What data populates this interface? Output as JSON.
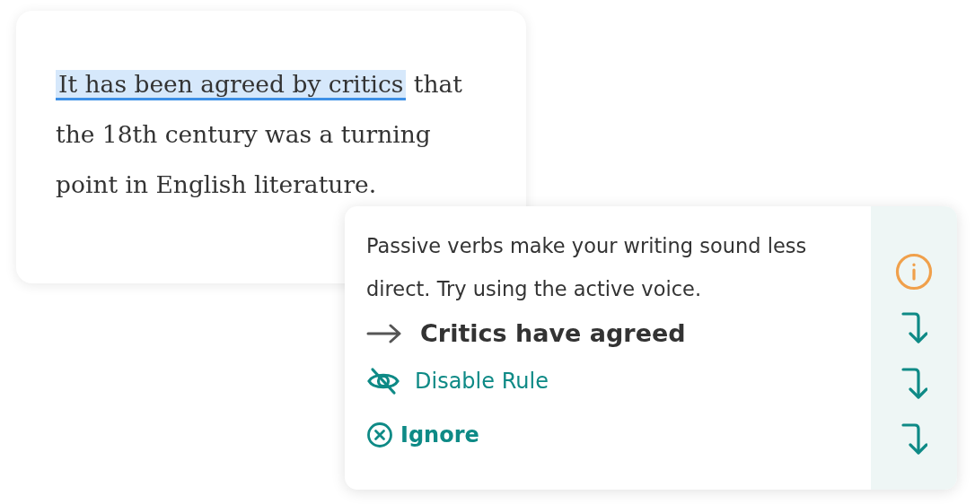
{
  "editor": {
    "highlighted_text": "It has been agreed by critics",
    "text": "that the 18th century was a turning point in English literature."
  },
  "suggestion": {
    "message": "Passive verbs make your writing sound less direct. Try using the active voice.",
    "replacement": "Critics have agreed",
    "actions": [
      {
        "kind": "disable",
        "label": "Disable Rule"
      },
      {
        "kind": "ignore",
        "label": "Ignore"
      }
    ],
    "side_icons": [
      {
        "kind": "info"
      },
      {
        "kind": "turn"
      },
      {
        "kind": "turn"
      },
      {
        "kind": "turn"
      }
    ]
  }
}
